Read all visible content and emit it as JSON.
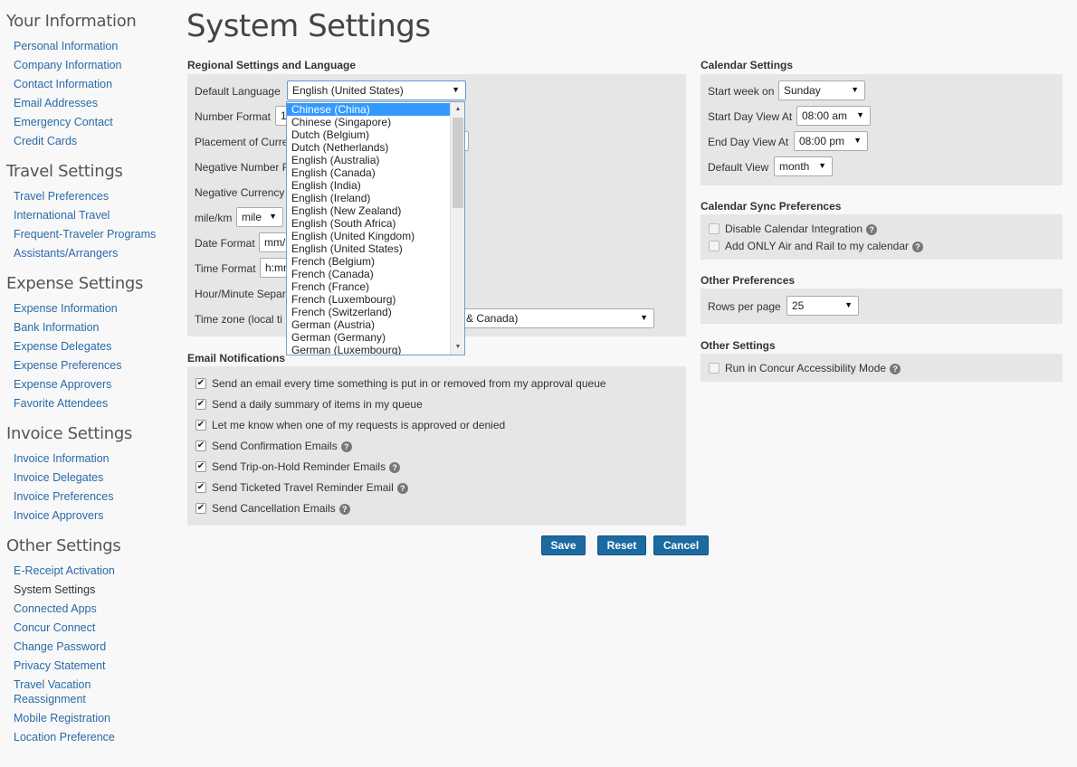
{
  "sidebar": {
    "groups": [
      {
        "heading": "Your Information",
        "items": [
          "Personal Information",
          "Company Information",
          "Contact Information",
          "Email Addresses",
          "Emergency Contact",
          "Credit Cards"
        ]
      },
      {
        "heading": "Travel Settings",
        "items": [
          "Travel Preferences",
          "International Travel",
          "Frequent-Traveler Programs",
          "Assistants/Arrangers"
        ]
      },
      {
        "heading": "Expense Settings",
        "items": [
          "Expense Information",
          "Bank Information",
          "Expense Delegates",
          "Expense Preferences",
          "Expense Approvers",
          "Favorite Attendees"
        ]
      },
      {
        "heading": "Invoice Settings",
        "items": [
          "Invoice Information",
          "Invoice Delegates",
          "Invoice Preferences",
          "Invoice Approvers"
        ]
      },
      {
        "heading": "Other Settings",
        "items": [
          "E-Receipt Activation",
          "System Settings",
          "Connected Apps",
          "Concur Connect",
          "Change Password",
          "Privacy Statement",
          "Travel Vacation",
          "Reassignment",
          "Mobile Registration",
          "Location Preference"
        ]
      }
    ],
    "current": "System Settings"
  },
  "page": {
    "title": "System Settings"
  },
  "regional": {
    "title": "Regional Settings and Language",
    "default_language_label": "Default Language",
    "default_language_value": "English (United States)",
    "number_format_label": "Number Format",
    "number_format_value": "1",
    "placement_label": "Placement of Curre",
    "negative_number_label": "Negative Number F",
    "negative_currency_label": "Negative Currency",
    "milekm_label": "mile/km",
    "milekm_value": "mile",
    "date_format_label": "Date Format",
    "date_format_value": "mm/",
    "time_format_label": "Time Format",
    "time_format_value": "h:mm",
    "hour_minute_label": "Hour/Minute Separ",
    "timezone_label": "Time zone (local ti",
    "timezone_value": "& Canada)"
  },
  "language_options": [
    "Chinese (China)",
    "Chinese (Singapore)",
    "Dutch (Belgium)",
    "Dutch (Netherlands)",
    "English (Australia)",
    "English (Canada)",
    "English (India)",
    "English (Ireland)",
    "English (New Zealand)",
    "English (South Africa)",
    "English (United Kingdom)",
    "English (United States)",
    "French (Belgium)",
    "French (Canada)",
    "French (France)",
    "French (Luxembourg)",
    "French (Switzerland)",
    "German (Austria)",
    "German (Germany)",
    "German (Luxembourg)"
  ],
  "language_highlighted": "Chinese (China)",
  "email": {
    "title": "Email Notifications",
    "items": [
      {
        "label": "Send an email every time something is put in or removed from my approval queue",
        "checked": true,
        "help": false
      },
      {
        "label": "Send a daily summary of items in my queue",
        "checked": true,
        "help": false
      },
      {
        "label": "Let me know when one of my requests is approved or denied",
        "checked": true,
        "help": false
      },
      {
        "label": "Send Confirmation Emails",
        "checked": true,
        "help": true
      },
      {
        "label": "Send Trip-on-Hold Reminder Emails",
        "checked": true,
        "help": true
      },
      {
        "label": "Send Ticketed Travel Reminder Email",
        "checked": true,
        "help": true
      },
      {
        "label": "Send Cancellation Emails",
        "checked": true,
        "help": true
      }
    ]
  },
  "calendar": {
    "title": "Calendar Settings",
    "start_week_label": "Start week on",
    "start_week_value": "Sunday",
    "start_day_label": "Start Day View At",
    "start_day_value": "08:00 am",
    "end_day_label": "End Day View At",
    "end_day_value": "08:00 pm",
    "default_view_label": "Default View",
    "default_view_value": "month"
  },
  "calendar_sync": {
    "title": "Calendar Sync Preferences",
    "disable_label": "Disable Calendar Integration",
    "air_rail_label": "Add ONLY Air and Rail to my calendar"
  },
  "other_prefs": {
    "title": "Other Preferences",
    "rows_label": "Rows per page",
    "rows_value": "25"
  },
  "other_settings": {
    "title": "Other Settings",
    "accessibility_label": "Run in Concur Accessibility Mode"
  },
  "actions": {
    "save": "Save",
    "reset": "Reset",
    "cancel": "Cancel"
  },
  "icons": {
    "dropdown_arrow": "▼",
    "check": "✔",
    "help": "?",
    "scroll_up": "▲",
    "scroll_down": "▼"
  },
  "colors": {
    "link": "#2a6aa8",
    "button": "#1c6aa2",
    "highlight": "#3399ff",
    "panel": "#e6e6e6"
  }
}
